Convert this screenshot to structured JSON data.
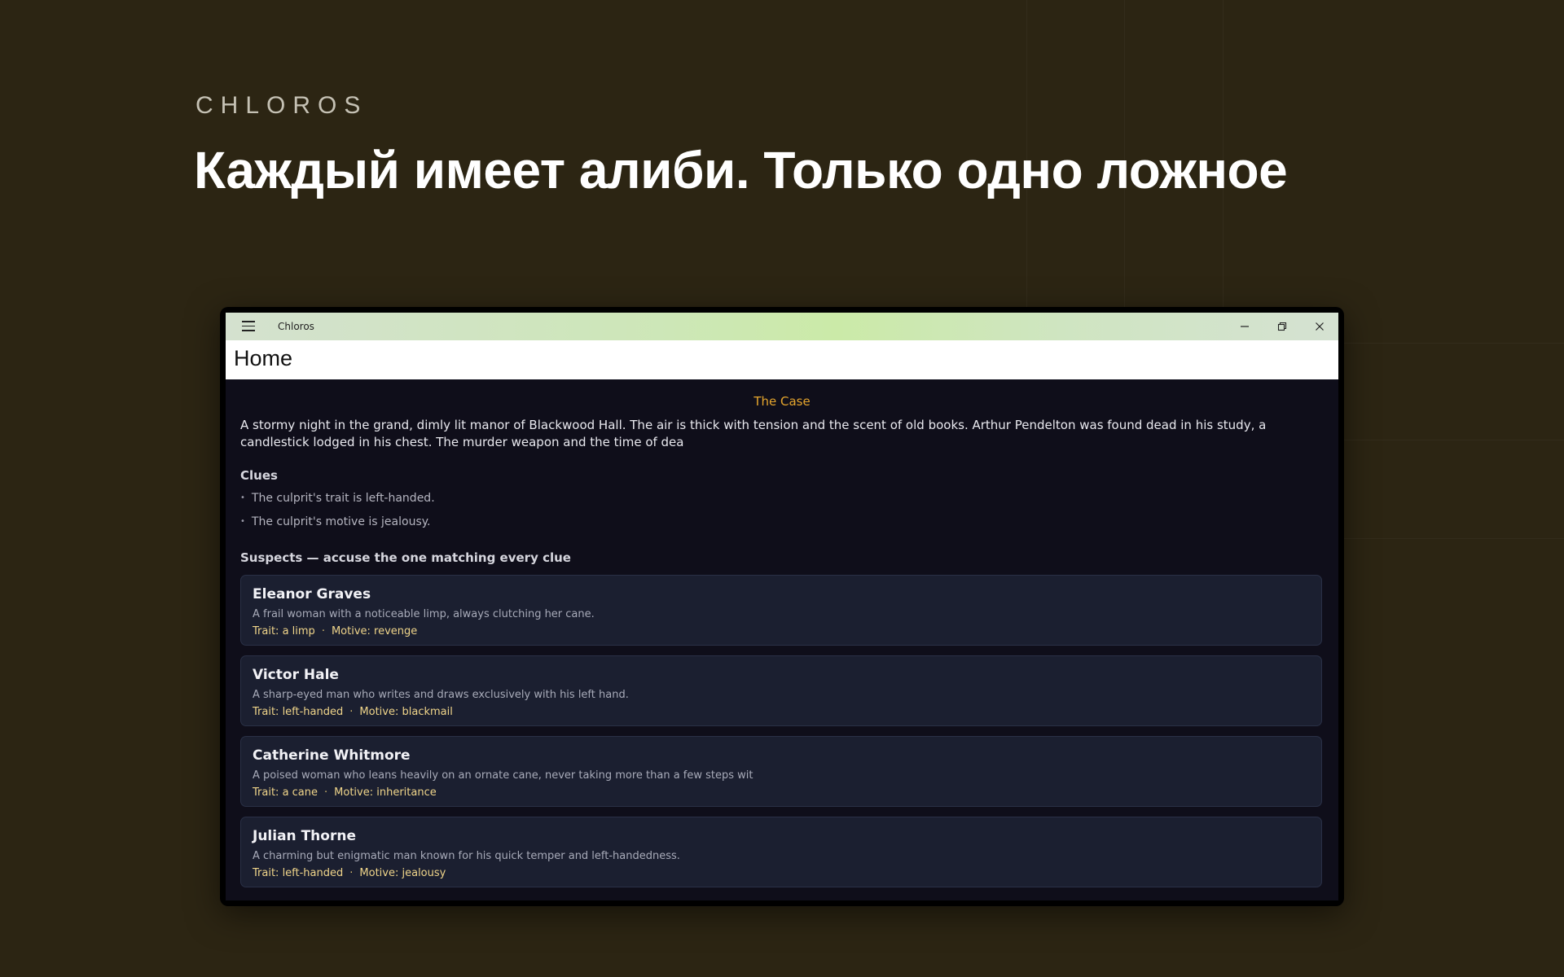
{
  "brand": "CHLOROS",
  "headline": "Каждый имеет алиби. Только одно ложное",
  "window": {
    "app_title": "Chloros",
    "menu_icon": "hamburger-menu-icon",
    "controls": [
      "minimize-icon",
      "restore-icon",
      "close-icon"
    ]
  },
  "header": {
    "title": "Home"
  },
  "case": {
    "heading": "The Case",
    "story": "A stormy night in the grand, dimly lit manor of Blackwood Hall. The air is thick with tension and the scent of old books. Arthur Pendelton was found dead in his study, a candlestick lodged in his chest. The murder weapon and the time of dea"
  },
  "clues": {
    "title": "Clues",
    "items": [
      "The culprit's trait is left-handed.",
      "The culprit's motive is jealousy."
    ]
  },
  "suspects": {
    "title": "Suspects — accuse the one matching every clue",
    "items": [
      {
        "name": "Eleanor Graves",
        "description": "A frail woman with a noticeable limp, always clutching her cane.",
        "trait": "Trait: a limp",
        "motive": "Motive: revenge"
      },
      {
        "name": "Victor Hale",
        "description": "A sharp-eyed man who writes and draws exclusively with his left hand.",
        "trait": "Trait: left-handed",
        "motive": "Motive: blackmail"
      },
      {
        "name": "Catherine Whitmore",
        "description": "A poised woman who leans heavily on an ornate cane, never taking more than a few steps wit",
        "trait": "Trait: a cane",
        "motive": "Motive: inheritance"
      },
      {
        "name": "Julian Thorne",
        "description": "A charming but enigmatic man known for his quick temper and left-handedness.",
        "trait": "Trait: left-handed",
        "motive": "Motive: jealousy"
      }
    ]
  },
  "colors": {
    "background": "#2c2513",
    "accent": "#e5a52d",
    "meta_text": "#f0d58a",
    "card_bg": "#1b1f30"
  }
}
